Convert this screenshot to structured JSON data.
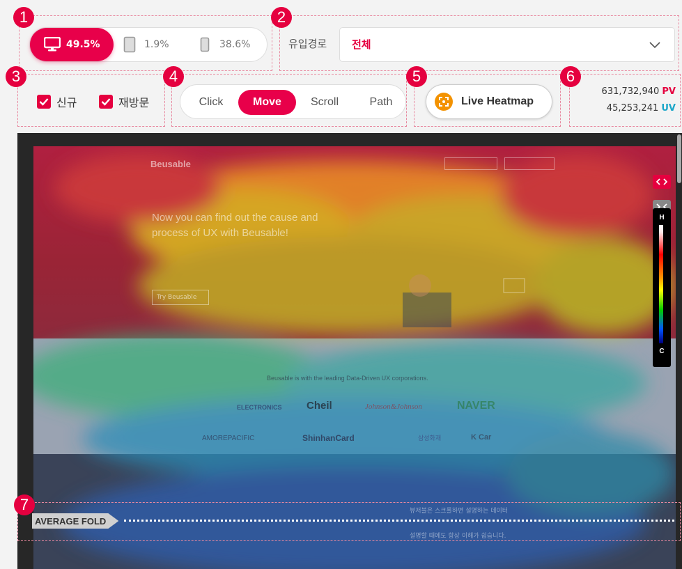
{
  "markers": [
    "1",
    "2",
    "3",
    "4",
    "5",
    "6",
    "7"
  ],
  "devices": [
    {
      "icon": "desktop-icon",
      "percent": "49.5%"
    },
    {
      "icon": "tablet-icon",
      "percent": "1.9%"
    },
    {
      "icon": "mobile-icon",
      "percent": "38.6%"
    }
  ],
  "referrer": {
    "label": "유입경로",
    "value": "전체"
  },
  "visitor_filters": [
    {
      "label": "신규",
      "checked": true
    },
    {
      "label": "재방문",
      "checked": true
    }
  ],
  "modes": [
    "Click",
    "Move",
    "Scroll",
    "Path"
  ],
  "active_mode": "Move",
  "live_heatmap_label": "Live Heatmap",
  "stats": {
    "pv": "631,732,940",
    "pv_label": "PV",
    "uv": "45,253,241",
    "uv_label": "UV"
  },
  "scale": {
    "high": "H",
    "cold": "C"
  },
  "fold_label": "AVERAGE FOLD",
  "site": {
    "brand": "Beusable",
    "headline_line1": "Now you can find out the cause and",
    "headline_line2": "process of UX with Beusable!",
    "cta": "Try Beusable",
    "partners_caption": "Beusable is with the leading Data-Driven UX corporations.",
    "partners_row1": [
      "ELECTRONICS",
      "Cheil",
      "Johnson&Johnson",
      "NAVER"
    ],
    "partners_row2": [
      "AMOREPACIFIC",
      "ShinhanCard",
      "삼성화재",
      "K Car"
    ],
    "dark_line1": "뷰저블은 스크롤하면 설명하는 데이터",
    "dark_line2": "설명할 때에도 항상 이해가 쉽습니다."
  },
  "colors": {
    "accent": "#e8004a",
    "pv": "#e5003f",
    "uv": "#1aa6c8"
  }
}
